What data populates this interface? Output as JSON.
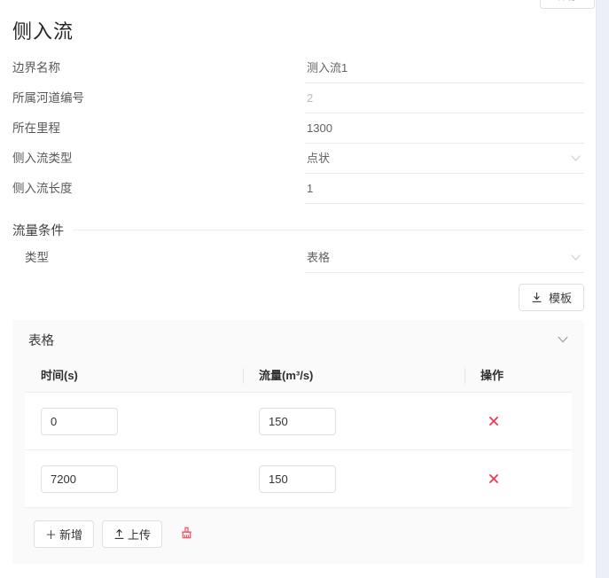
{
  "colors": {
    "page_background": "#eceff7",
    "panel_background": "#ffffff",
    "card_background": "#fafafa",
    "text_primary": "#303133",
    "text_label": "#585858",
    "border": "#dcdfe6",
    "danger": "#f5576c",
    "disabled_text": "#b9bcc4"
  },
  "top_action": {
    "label": "保存"
  },
  "page_title": "侧入流",
  "form": {
    "fields": [
      {
        "label": "边界名称",
        "value": "测入流1",
        "type": "text",
        "disabled": false
      },
      {
        "label": "所属河道编号",
        "value": "2",
        "type": "text",
        "disabled": true
      },
      {
        "label": "所在里程",
        "value": "1300",
        "type": "text",
        "disabled": false
      },
      {
        "label": "侧入流类型",
        "value": "点状",
        "type": "select",
        "disabled": false
      },
      {
        "label": "侧入流长度",
        "value": "1",
        "type": "text",
        "disabled": false
      }
    ]
  },
  "flow_section": {
    "title": "流量条件",
    "type_row": {
      "label": "类型",
      "value": "表格"
    },
    "template_button": {
      "label": "模板",
      "icon": "download-icon"
    }
  },
  "collapse": {
    "title": "表格",
    "chevron_icon": "chevron-down-icon"
  },
  "table": {
    "headers": [
      "时间(s)",
      "流量(m³/s)",
      "操作"
    ],
    "rows": [
      {
        "time": "0",
        "flow": "150",
        "delete_icon": "close-x-icon"
      },
      {
        "time": "7200",
        "flow": "150",
        "delete_icon": "close-x-icon"
      }
    ],
    "footer": {
      "add_button": {
        "label": "新增",
        "icon": "plus-icon"
      },
      "upload_button": {
        "label": "上传",
        "icon": "upload-icon"
      },
      "clear_button": {
        "label": "清空",
        "icon": "broom-icon"
      }
    }
  }
}
